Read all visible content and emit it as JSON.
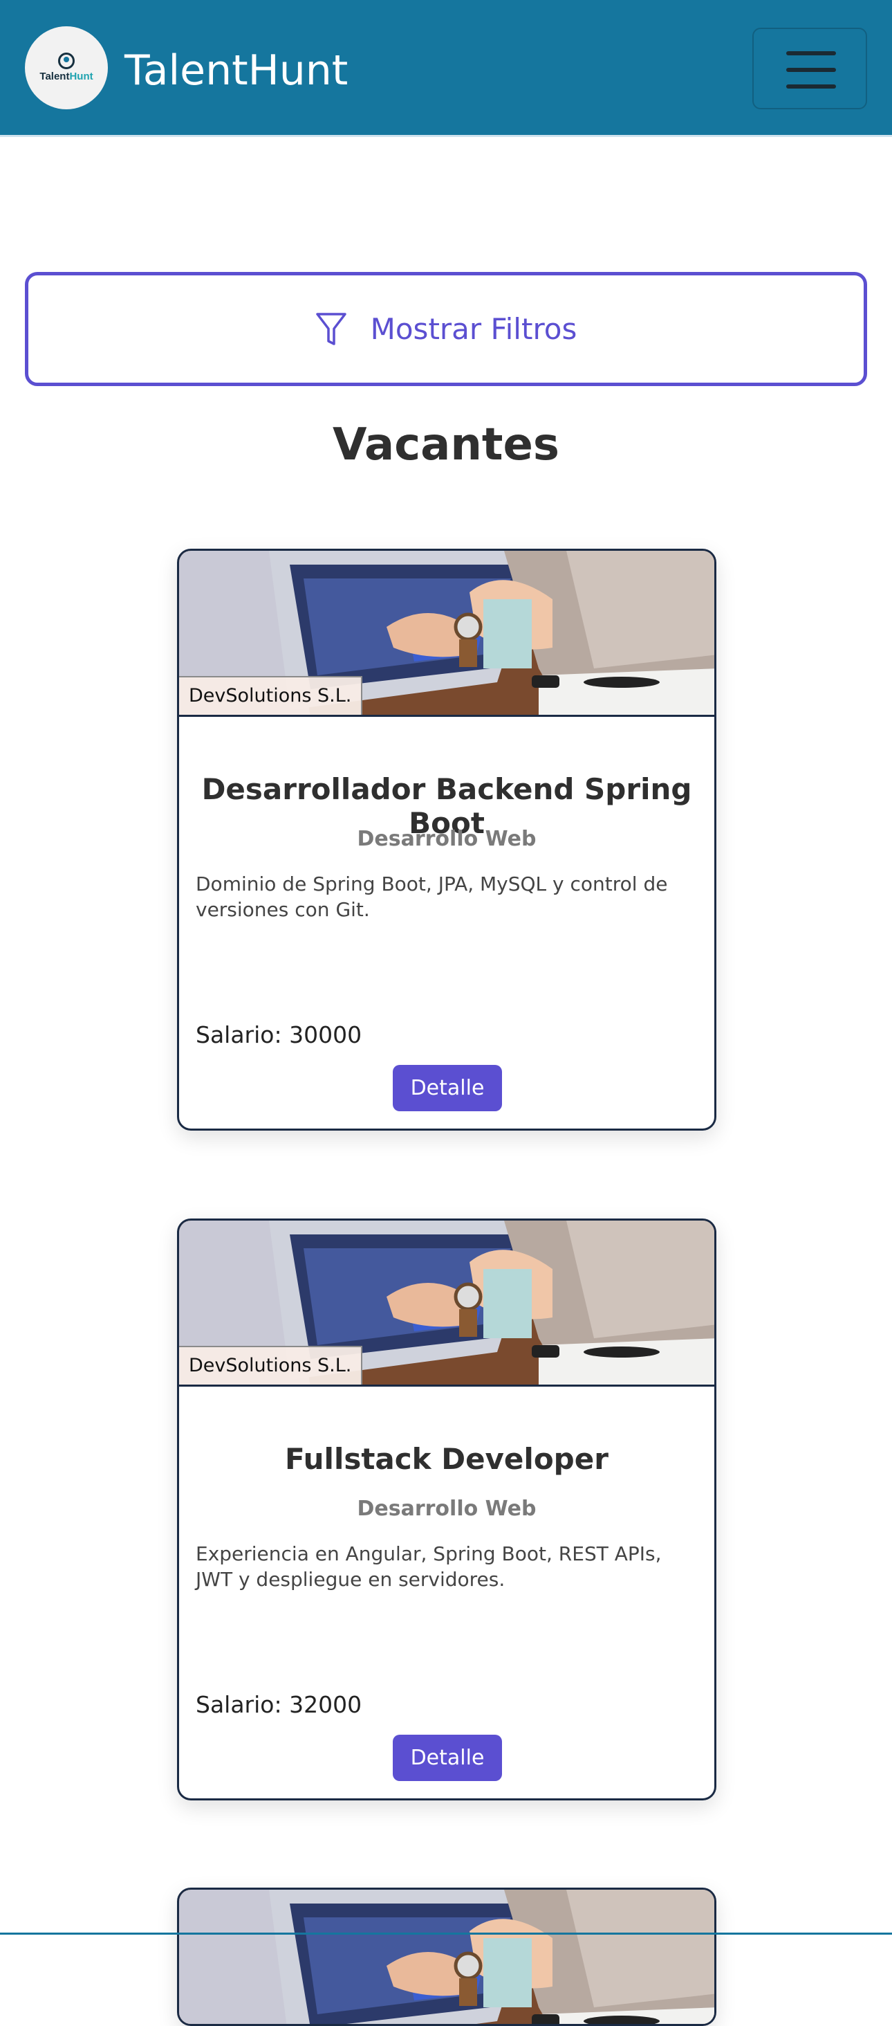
{
  "navbar": {
    "brand": "TalentHunt",
    "logo": {
      "text_main": "Talent",
      "text_accent": "Hunt"
    },
    "menu_icon": "hamburger-icon"
  },
  "filters": {
    "label": "Mostrar Filtros",
    "icon": "filter-icon"
  },
  "section": {
    "title": "Vacantes"
  },
  "vacancies": [
    {
      "company": "DevSolutions S.L.",
      "title": "Desarrollador Backend Spring Boot",
      "category": "Desarrollo Web",
      "description": "Dominio de Spring Boot, JPA, MySQL y control de versiones con Git.",
      "salary": "Salario: 30000",
      "button": "Detalle"
    },
    {
      "company": "DevSolutions S.L.",
      "title": "Fullstack Developer",
      "category": "Desarrollo Web",
      "description": "Experiencia en Angular, Spring Boot, REST APIs, JWT y despliegue en servidores.",
      "salary": "Salario: 32000",
      "button": "Detalle"
    }
  ],
  "colors": {
    "navbar": "#15769e",
    "accent": "#5b4fd1",
    "card_border": "#1a2a44"
  }
}
